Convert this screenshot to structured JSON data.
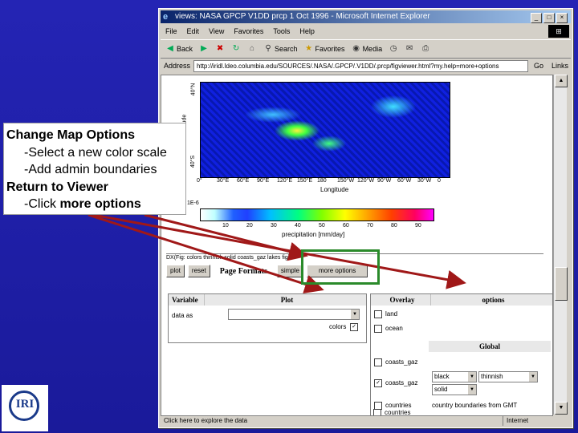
{
  "browser": {
    "title": "views: NASA GPCP V1DD prcp 1 Oct 1996 - Microsoft Internet Explorer",
    "menu": [
      "File",
      "Edit",
      "View",
      "Favorites",
      "Tools",
      "Help"
    ],
    "toolbar": {
      "back": "Back",
      "search": "Search",
      "favorites": "Favorites",
      "media": "Media"
    },
    "address_label": "Address",
    "address_value": "http://iridl.ldeo.columbia.edu/SOURCES/.NASA/.GPCP/.V1DD/.prcp/figviewer.html?my.help=more+options",
    "go": "Go",
    "links": "Links",
    "status": "Click here to explore the data",
    "zone": "Internet"
  },
  "map": {
    "lon_ticks": [
      "0°",
      "30°E",
      "60°E",
      "90°E",
      "120°E",
      "150°E",
      "180",
      "150°W",
      "120°W",
      "90°W",
      "60°W",
      "30°W",
      "0"
    ],
    "xlabel": "Longitude",
    "lat_top": "40°N",
    "lat_bottom": "40°S",
    "side_label": "tude",
    "colorbar_ticks": [
      "10",
      "20",
      "30",
      "40",
      "50",
      "60",
      "70",
      "80",
      "90"
    ],
    "colorbar_prefix": "1E-6",
    "colorbar_label": "precipitation [mm/day]"
  },
  "controls": {
    "expert_text": "DX(Fig: colors thinnish solid coasts_gaz lakes fig)",
    "buttons": [
      "plot",
      "reset"
    ],
    "page_formats": "Page Formats",
    "simple": "simple",
    "more_options": "more options"
  },
  "variable_table": {
    "col1": "Variable",
    "col2": "Plot",
    "row_label": "data as",
    "colors_label": "colors"
  },
  "overlay_table": {
    "col1": "Overlay",
    "col2": "options",
    "land": "land",
    "ocean": "ocean",
    "global": "Global",
    "coasts_gaz_top": "coasts_gaz",
    "coasts_gaz": "coasts_gaz",
    "color_value": "black",
    "thickness_value": "thinnish",
    "style_value": "solid",
    "countries": "countries",
    "countries_desc": "country boundaries from GMT",
    "countries2": "countries"
  },
  "annotation": {
    "title": "Change Map Options",
    "line1": "-Select a new color scale",
    "line2": "-Add admin boundaries",
    "title2": "Return to Viewer",
    "line3_prefix": "-Click ",
    "line3_bold": "more options"
  },
  "logo": {
    "text": "IRI"
  },
  "colors": {
    "slide_bg": "#1a1aa0",
    "highlight": "#2a8a2a",
    "arrow": "#a01818"
  }
}
